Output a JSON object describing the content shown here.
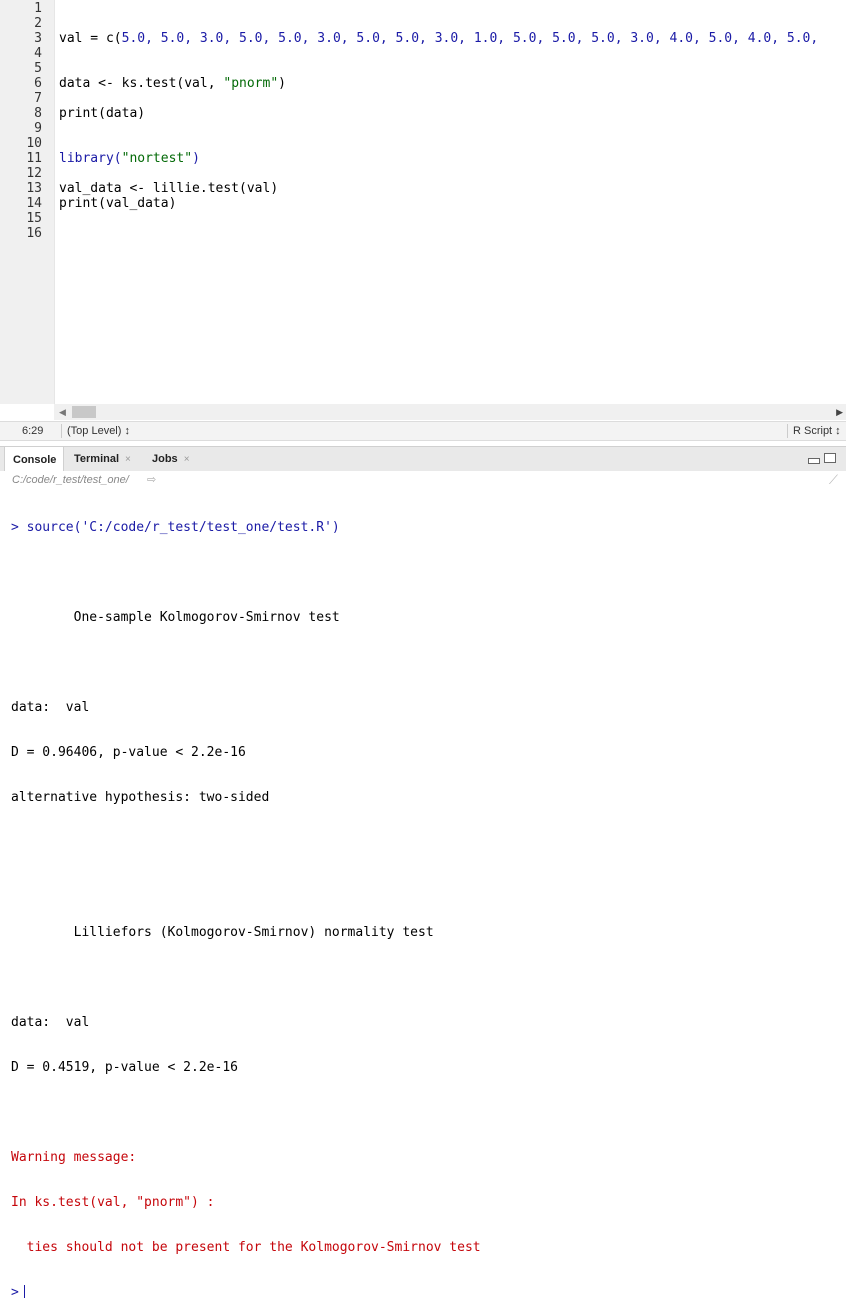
{
  "editor": {
    "line_numbers": [
      "1",
      "2",
      "3",
      "4",
      "5",
      "6",
      "7",
      "8",
      "9",
      "10",
      "11",
      "12",
      "13",
      "14",
      "15",
      "16"
    ],
    "lines": {
      "l3": {
        "prefix": "val = c(",
        "values": "5.0, 5.0, 3.0, 5.0, 5.0, 3.0, 5.0, 5.0, 3.0, 1.0, 5.0, 5.0, 5.0, 3.0, 4.0, 5.0, 4.0, 5.0, "
      },
      "l6": {
        "text": "data <- ks.test(val, ",
        "str": "\"pnorm\"",
        "close": ")"
      },
      "l8": {
        "text": "print(data)"
      },
      "l11": {
        "fn": "library(",
        "str": "\"nortest\"",
        "close": ")"
      },
      "l13": {
        "text": "val_data <- lillie.test(val)"
      },
      "l14": {
        "text": "print(val_data)"
      }
    }
  },
  "status_bar": {
    "position": "6:29",
    "scope": "(Top Level) ↕",
    "file_type": "R Script ↕"
  },
  "tabs": [
    {
      "label": "Console"
    },
    {
      "label": "Terminal",
      "close": "×"
    },
    {
      "label": "Jobs",
      "close": "×"
    }
  ],
  "console": {
    "path": "C:/code/r_test/test_one/",
    "lines": {
      "cmd": "> source('C:/code/r_test/test_one/test.R')",
      "ks_title": "        One-sample Kolmogorov-Smirnov test",
      "ks_data": "data:  val",
      "ks_stat": "D = 0.96406, p-value < 2.2e-16",
      "ks_alt": "alternative hypothesis: two-sided",
      "lil_title": "        Lilliefors (Kolmogorov-Smirnov) normality test",
      "lil_data": "data:  val",
      "lil_stat": "D = 0.4519, p-value < 2.2e-16",
      "warn1": "Warning message:",
      "warn2": "In ks.test(val, \"pnorm\") :",
      "warn3": "  ties should not be present for the Kolmogorov-Smirnov test",
      "prompt": ">"
    }
  },
  "colors": {
    "number": "#1a1aa6",
    "string": "#036a07",
    "warning": "#c5060b"
  },
  "icons": [
    "goto-dir-icon",
    "broom-icon",
    "minimize-pane-icon",
    "maximize-pane-icon",
    "scroll-left-icon",
    "scroll-right-icon"
  ]
}
